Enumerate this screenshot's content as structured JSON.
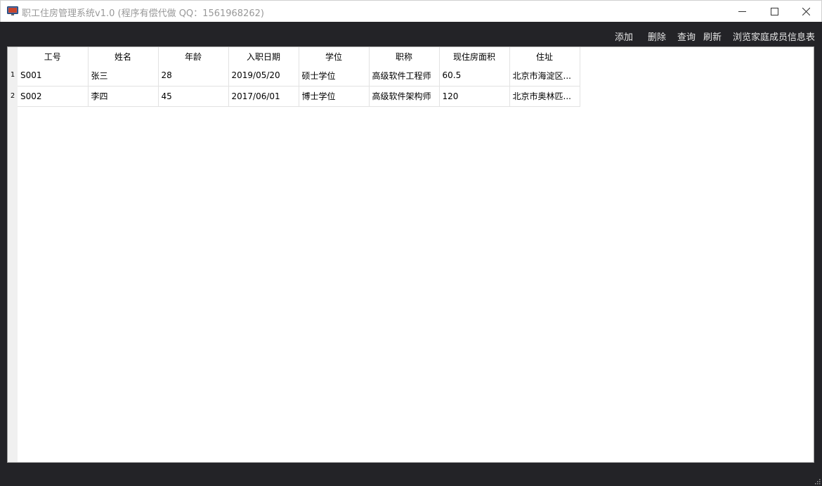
{
  "window": {
    "title": "职工住房管理系统v1.0 (程序有偿代做 QQ：1561968262)",
    "icons": [
      "app-icon",
      "minimize-icon",
      "maximize-icon",
      "close-icon"
    ]
  },
  "toolbar": {
    "add": "添加",
    "delete": "删除",
    "query": "查询",
    "refresh": "刷新",
    "family": "浏览家庭成员信息表"
  },
  "table": {
    "columns": [
      "工号",
      "姓名",
      "年龄",
      "入职日期",
      "学位",
      "职称",
      "现住房面积",
      "住址"
    ],
    "row_numbers": [
      "1",
      "2"
    ],
    "rows": [
      [
        "S001",
        "张三",
        "28",
        "2019/05/20",
        "硕士学位",
        "高级软件工程师",
        "60.5",
        "北京市海淀区..."
      ],
      [
        "S002",
        "李四",
        "45",
        "2017/06/01",
        "博士学位",
        "高级软件架构师",
        "120",
        "北京市奥林匹..."
      ]
    ]
  },
  "colors": {
    "background": "#232327",
    "toolbar_text": "#e6e6e6",
    "title_text": "#999999",
    "table_bg": "#ffffff"
  }
}
